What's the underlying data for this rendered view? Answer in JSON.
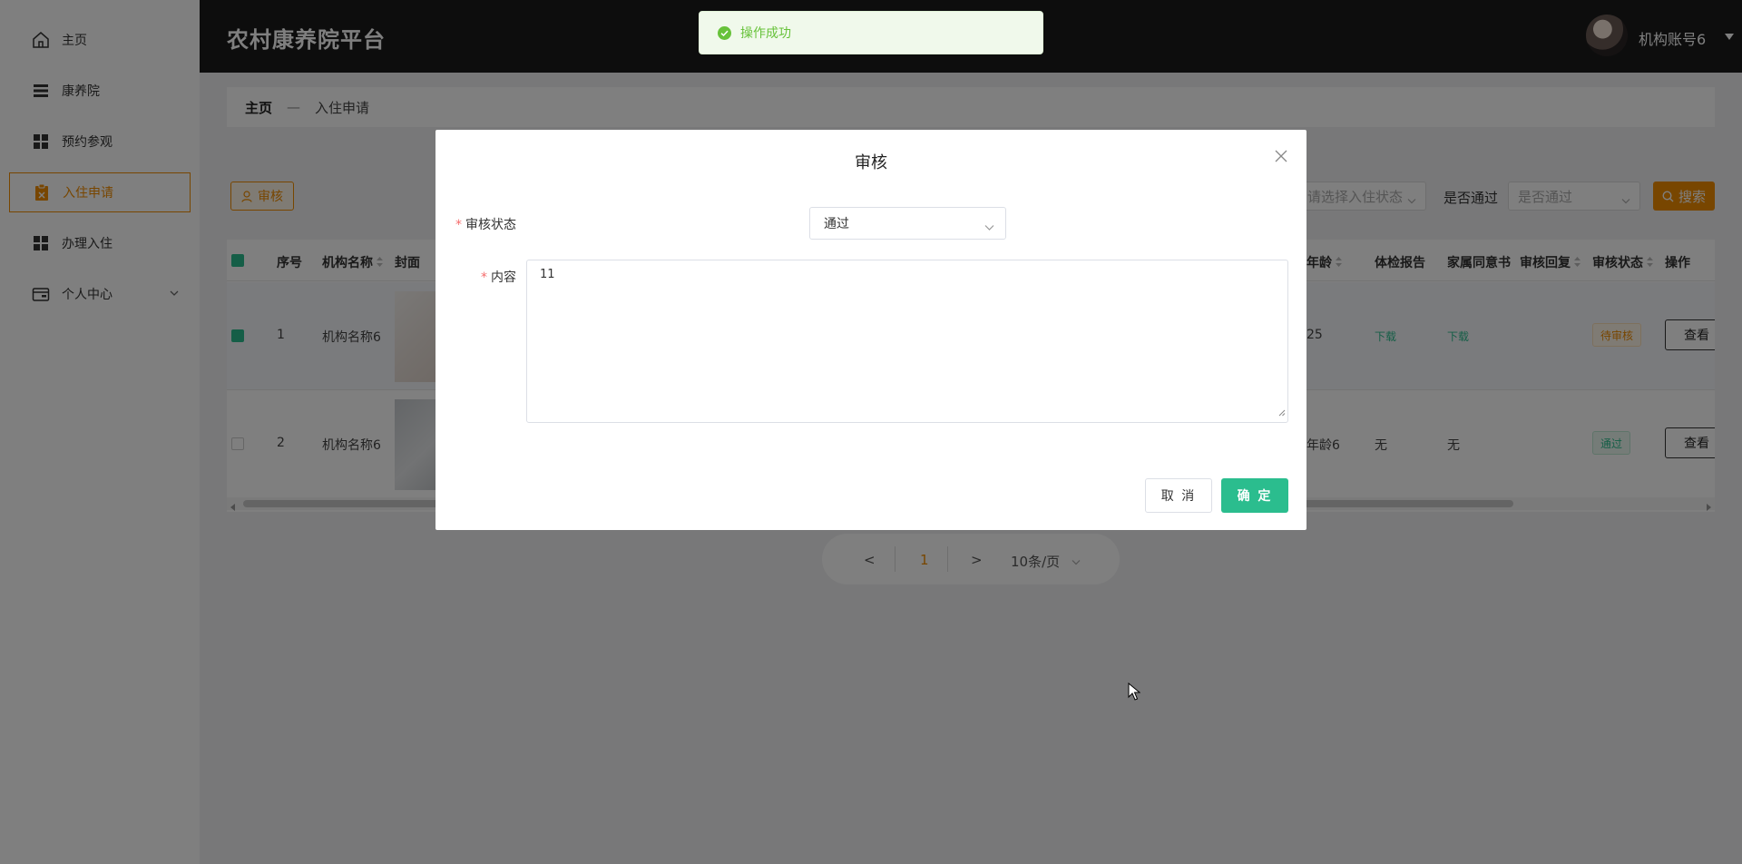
{
  "app": {
    "title": "农村康养院平台",
    "account_name": "机构账号6"
  },
  "sidebar": {
    "items": [
      {
        "label": "主页",
        "icon": "home-icon"
      },
      {
        "label": "康养院",
        "icon": "list-icon"
      },
      {
        "label": "预约参观",
        "icon": "grid-icon"
      },
      {
        "label": "入住申请",
        "icon": "clipboard-icon",
        "active": true
      },
      {
        "label": "办理入住",
        "icon": "grid-icon"
      },
      {
        "label": "个人中心",
        "icon": "wallet-icon",
        "has_submenu": true
      }
    ]
  },
  "breadcrumb": {
    "home": "主页",
    "separator": "—",
    "current": "入住申请"
  },
  "toolbar": {
    "audit_label": "审核",
    "checkin_status_placeholder": "请选择入住状态",
    "passed_label": "是否通过",
    "passed_placeholder": "是否通过",
    "search_label": "搜索"
  },
  "table": {
    "columns": {
      "index": "序号",
      "org_name": "机构名称",
      "cover": "封面",
      "age": "年龄",
      "health_report": "体检报告",
      "family_consent": "家属同意书",
      "audit_reply": "审核回复",
      "audit_status": "审核状态",
      "action": "操作"
    },
    "rows": [
      {
        "index": "1",
        "org_name": "机构名称6",
        "age": "25",
        "health_report": "下载",
        "family_consent": "下载",
        "audit_status": "待审核",
        "action": "查看",
        "checked": true
      },
      {
        "index": "2",
        "org_name": "机构名称6",
        "age": "年龄6",
        "health_report": "无",
        "family_consent": "无",
        "audit_status": "通过",
        "action": "查看",
        "checked": false
      }
    ]
  },
  "pagination": {
    "prev": "<",
    "current_page": "1",
    "next": ">",
    "page_size": "10条/页"
  },
  "toast": {
    "message": "操作成功"
  },
  "modal": {
    "title": "审核",
    "status_label": "审核状态",
    "status_value": "通过",
    "content_label": "内容",
    "content_value": "11",
    "cancel_label": "取 消",
    "confirm_label": "确 定"
  },
  "colors": {
    "accent": "#f08c00",
    "success": "#2bbd8e",
    "header_bg": "#1a1a1a"
  }
}
